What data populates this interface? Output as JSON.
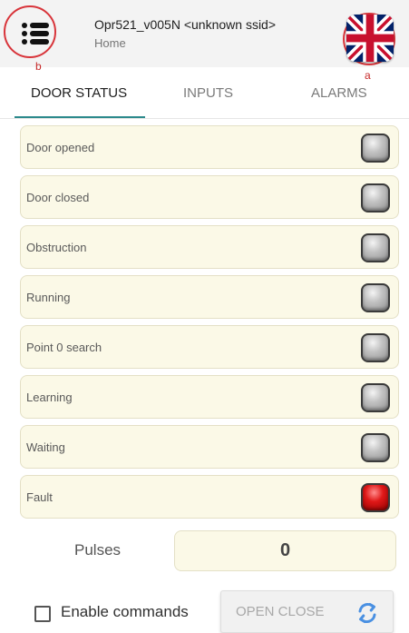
{
  "header": {
    "title": "Opr521_v005N <unknown ssid>",
    "subtitle": "Home",
    "annotation_a": "a",
    "annotation_b": "b",
    "menu_icon": "hamburger-menu-icon",
    "language_icon": "uk-flag-icon"
  },
  "tabs": [
    {
      "label": "DOOR STATUS",
      "active": true
    },
    {
      "label": "INPUTS",
      "active": false
    },
    {
      "label": "ALARMS",
      "active": false
    }
  ],
  "status_items": [
    {
      "label": "Door opened",
      "indicator": "off"
    },
    {
      "label": "Door closed",
      "indicator": "off"
    },
    {
      "label": "Obstruction",
      "indicator": "off"
    },
    {
      "label": "Running",
      "indicator": "off"
    },
    {
      "label": "Point 0 search",
      "indicator": "off"
    },
    {
      "label": "Learning",
      "indicator": "off"
    },
    {
      "label": "Waiting",
      "indicator": "off"
    },
    {
      "label": "Fault",
      "indicator": "on"
    }
  ],
  "pulses": {
    "label": "Pulses",
    "value": "0"
  },
  "controls": {
    "enable_label": "Enable commands",
    "enable_checked": false,
    "open_close_label": "OPEN CLOSE",
    "refresh_icon": "refresh-icon"
  },
  "colors": {
    "accent": "#2c8a8c",
    "row_background": "#fbf9e7",
    "indicator_on": "#e01818",
    "indicator_off": "#b5b5b5",
    "annotation": "#d8343a"
  }
}
